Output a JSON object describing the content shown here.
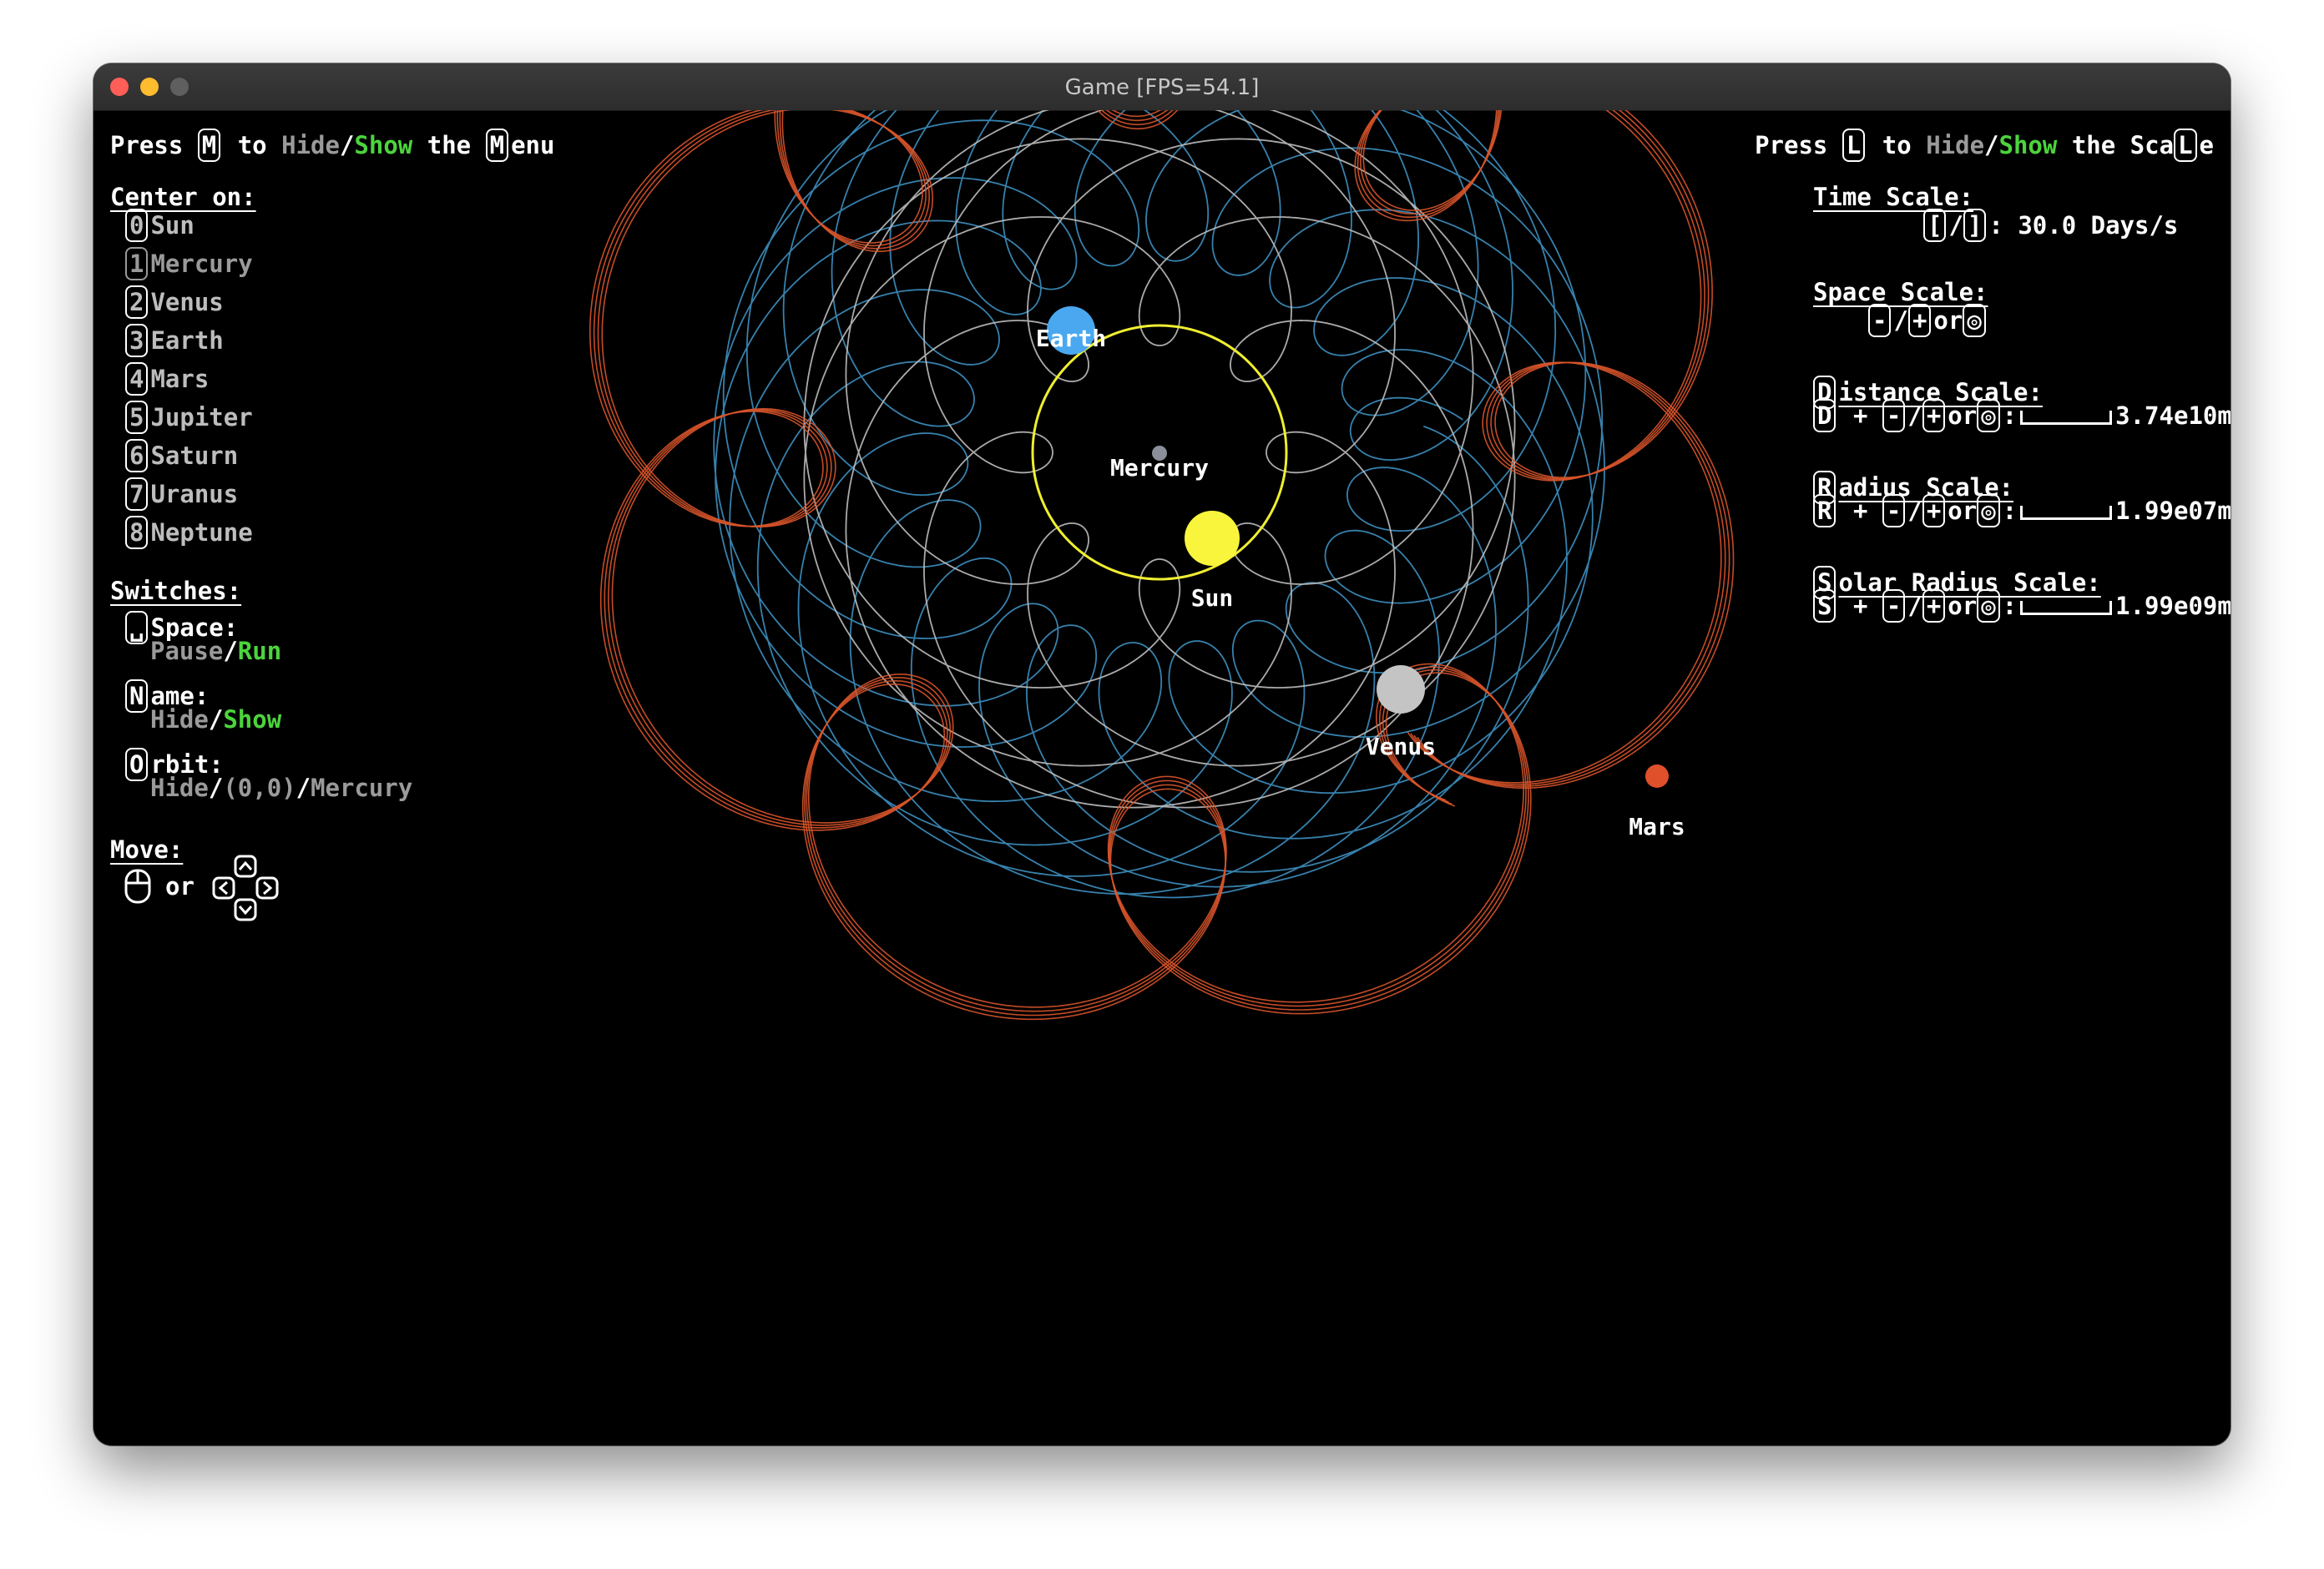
{
  "window": {
    "title": "Game [FPS=54.1]"
  },
  "top_left": {
    "press": "Press",
    "key": "M",
    "to": "to",
    "hide": "Hide",
    "slash": "/",
    "show": "Show",
    "the": "the",
    "menu_key": "M",
    "menu_rest": "enu"
  },
  "top_right": {
    "press": "Press",
    "key": "L",
    "to": "to",
    "hide": "Hide",
    "slash": "/",
    "show": "Show",
    "the": "the",
    "scale_pre": "Sca",
    "scale_key": "L",
    "scale_post": "e"
  },
  "center_on": {
    "heading": "Center on:",
    "items": [
      {
        "key": "0",
        "label": "Sun"
      },
      {
        "key": "1",
        "label": "Mercury",
        "selected": true
      },
      {
        "key": "2",
        "label": "Venus"
      },
      {
        "key": "3",
        "label": "Earth"
      },
      {
        "key": "4",
        "label": "Mars"
      },
      {
        "key": "5",
        "label": "Jupiter"
      },
      {
        "key": "6",
        "label": "Saturn"
      },
      {
        "key": "7",
        "label": "Uranus"
      },
      {
        "key": "8",
        "label": "Neptune"
      }
    ]
  },
  "switches": {
    "heading": "Switches:",
    "space": {
      "key": "␣",
      "label": "Space:",
      "opt1": "Pause",
      "slash": "/",
      "opt2": "Run"
    },
    "name": {
      "key": "N",
      "rest": "ame:",
      "opt1": "Hide",
      "slash": "/",
      "opt2": "Show"
    },
    "orbit": {
      "key": "O",
      "rest": "rbit:",
      "opt1": "Hide",
      "opt2": "(0,0)",
      "opt3": "Mercury",
      "slash": "/"
    }
  },
  "move": {
    "heading": "Move:",
    "or": "or",
    "mouse_icon": "mouse-icon",
    "arrows_icon": "arrow-keys-icon"
  },
  "time_scale": {
    "heading": "Time Scale:",
    "key1": "[",
    "key2": "]",
    "slash": "/",
    "value": ": 30.0 Days/s"
  },
  "space_scale": {
    "heading": "Space Scale:",
    "key_minus": "-",
    "key_plus": "+",
    "slash": "/",
    "or": "or"
  },
  "distance_scale": {
    "key": "D",
    "rest": "istance Scale:",
    "value": "3.74e10m",
    "plus": "+",
    "slash": "/",
    "or": "or",
    "colon": ":",
    "level": 0.0
  },
  "radius_scale": {
    "key": "R",
    "rest": "adius Scale:",
    "value": "1.99e07m",
    "plus": "+",
    "slash": "/",
    "or": "or",
    "colon": ":",
    "level": 0.0
  },
  "solar_radius_scale": {
    "key": "S",
    "rest": "olar Radius Scale:",
    "value": "1.99e09m",
    "plus": "+",
    "slash": "/",
    "or": "or",
    "colon": ":",
    "level": 0.0
  },
  "bodies": [
    {
      "name": "Mercury",
      "color": "#8a8f99"
    },
    {
      "name": "Earth",
      "color": "#4aa8f0"
    },
    {
      "name": "Sun",
      "color": "#f8f53c"
    },
    {
      "name": "Venus",
      "color": "#c4c4c4"
    },
    {
      "name": "Mars",
      "color": "#e0502a"
    }
  ],
  "orbit_colors": {
    "sun": "#f0ee30",
    "venus": "#bdbdbd",
    "earth": "#3d8fc0",
    "mars": "#d9542a"
  }
}
